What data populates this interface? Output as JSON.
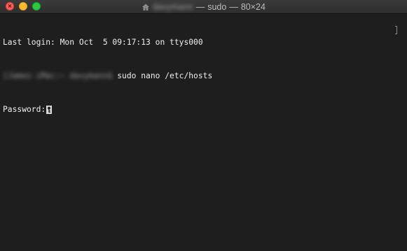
{
  "window": {
    "title_user": "davymann",
    "title_sep1": " — ",
    "title_process": "sudo",
    "title_sep2": " — ",
    "title_size": "80×24"
  },
  "traffic_lights": {
    "close_color": "#fd5f57",
    "minimize_color": "#febc2e",
    "zoom_color": "#28c840"
  },
  "terminal": {
    "background": "#1e1e1e",
    "foreground": "#f0f0f0",
    "last_login": "Last login: Mon Oct  5 09:17:13 on ttys000",
    "prompt_host": "[James-iMac:~ davymann$",
    "command": " sudo nano /etc/hosts",
    "password_label": "Password:"
  },
  "icons": {
    "home": "home-icon",
    "key": "key-icon"
  }
}
